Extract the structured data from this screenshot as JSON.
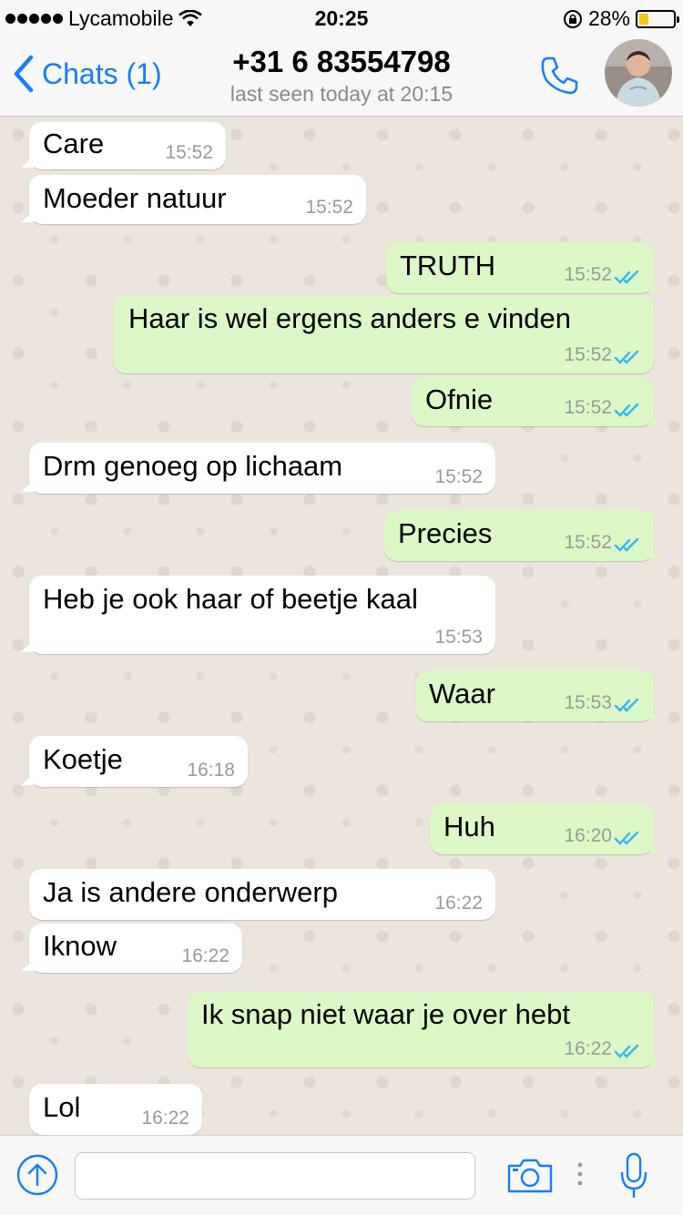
{
  "status_bar": {
    "carrier": "Lycamobile",
    "time": "20:25",
    "battery_percent": "28%",
    "battery_level": 0.28,
    "battery_color": "#f5c518"
  },
  "header": {
    "back_label": "Chats (1)",
    "contact_name": "+31 6 83554798",
    "last_seen": "last seen today at 20:15",
    "call_icon": "phone-icon",
    "avatar": "contact-avatar"
  },
  "messages": [
    {
      "direction": "in",
      "text": "Care",
      "time": "15:52"
    },
    {
      "direction": "in",
      "text": "Moeder natuur",
      "time": "15:52"
    },
    {
      "direction": "out",
      "text": "TRUTH",
      "time": "15:52"
    },
    {
      "direction": "out",
      "text": "Haar is wel ergens anders e vinden",
      "time": "15:52"
    },
    {
      "direction": "out",
      "text": "Ofnie",
      "time": "15:52"
    },
    {
      "direction": "in",
      "text": "Drm genoeg op lichaam",
      "time": "15:52"
    },
    {
      "direction": "out",
      "text": "Precies",
      "time": "15:52"
    },
    {
      "direction": "in",
      "text": "Heb je ook haar of beetje kaal",
      "time": "15:53"
    },
    {
      "direction": "out",
      "text": "Waar",
      "time": "15:53"
    },
    {
      "direction": "in",
      "text": "Koetje",
      "time": "16:18"
    },
    {
      "direction": "out",
      "text": "Huh",
      "time": "16:20"
    },
    {
      "direction": "in",
      "text": "Ja is andere onderwerp",
      "time": "16:22"
    },
    {
      "direction": "in",
      "text": "Iknow",
      "time": "16:22"
    },
    {
      "direction": "out",
      "text": "Ik snap niet waar je over hebt",
      "time": "16:22"
    },
    {
      "direction": "in",
      "text": "Lol",
      "time": "16:22"
    }
  ],
  "input_bar": {
    "placeholder": "",
    "icons": [
      "upload-icon",
      "camera-icon",
      "microphone-icon"
    ]
  },
  "colors": {
    "accent": "#157efb",
    "outgoing_bubble": "#dcf8c6",
    "incoming_bubble": "#ffffff",
    "read_ticks": "#34b7f1"
  }
}
